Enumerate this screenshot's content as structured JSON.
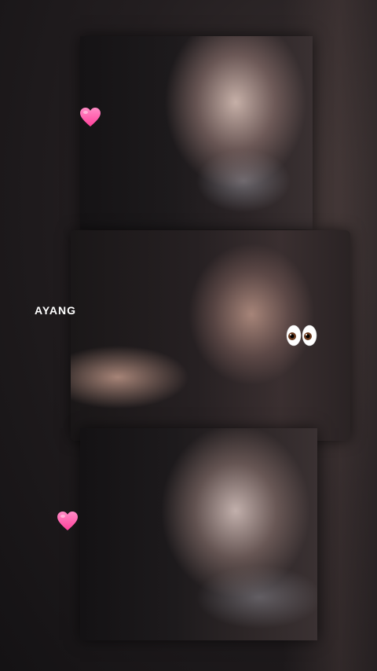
{
  "overlay": {
    "caption": "AYANG",
    "stickers": [
      "heart-icon",
      "eyes-icon",
      "heart-icon"
    ]
  },
  "photos": [
    {
      "name": "photo-top"
    },
    {
      "name": "photo-middle"
    },
    {
      "name": "photo-bottom"
    }
  ],
  "colors": {
    "background": "#231e20",
    "heart": "#ff4fa3",
    "caption": "#ffffff"
  }
}
